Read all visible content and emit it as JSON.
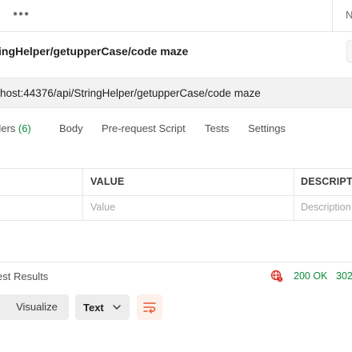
{
  "topbar": {
    "more_icon": "more-dots-icon",
    "right_text": "N"
  },
  "request": {
    "title": "ingHelper/getupperCase/code maze",
    "url": "host:44376/api/StringHelper/getupperCase/code maze"
  },
  "tabs": [
    {
      "label": "ders",
      "count": "(6)"
    },
    {
      "label": "Body"
    },
    {
      "label": "Pre-request Script"
    },
    {
      "label": "Tests"
    },
    {
      "label": "Settings"
    }
  ],
  "params_table": {
    "headers": [
      "VALUE",
      "DESCRIPTIC"
    ],
    "placeholders": [
      "Value",
      "Description"
    ]
  },
  "response": {
    "tab_label": "est Results",
    "globe_icon": "globe-warning-icon",
    "status": "200 OK",
    "time": "302",
    "status_color": "#0f8a3c"
  },
  "toolbar": {
    "visualize_label": "Visualize",
    "format_value": "Text",
    "wrap_icon": "wrap-lines-icon",
    "accent": "#e8542c"
  }
}
